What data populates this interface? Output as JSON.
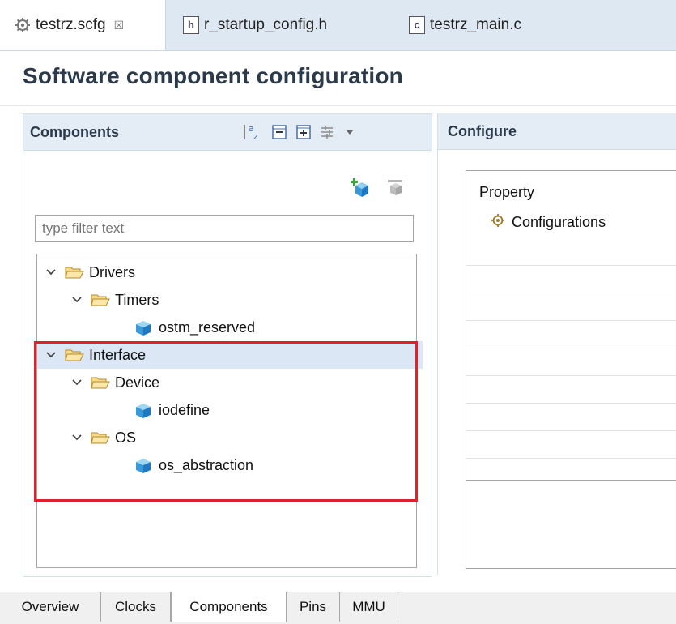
{
  "editor_tabs": [
    {
      "label": "testrz.scfg",
      "icon": "gear-file-icon",
      "active": true,
      "close_glyph": "☒"
    },
    {
      "label": "r_startup_config.h",
      "icon": "h-file-icon",
      "glyph": "h"
    },
    {
      "label": "testrz_main.c",
      "icon": "c-file-icon",
      "glyph": "c"
    }
  ],
  "page": {
    "title": "Software component configuration"
  },
  "components": {
    "title": "Components",
    "toolbar_icons": [
      "sort-az-icon",
      "collapse-all-icon",
      "expand-all-icon",
      "filter-icon",
      "dropdown-icon"
    ],
    "sort_glyph": "↓ᵃz",
    "filter_placeholder": "type filter text",
    "tree": [
      {
        "label": "Drivers",
        "type": "folder",
        "level": 0,
        "expanded": true
      },
      {
        "label": "Timers",
        "type": "folder",
        "level": 1,
        "expanded": true
      },
      {
        "label": "ostm_reserved",
        "type": "component",
        "level": 2
      },
      {
        "label": "Interface",
        "type": "folder",
        "level": 0,
        "expanded": true,
        "selected": true
      },
      {
        "label": "Device",
        "type": "folder",
        "level": 1,
        "expanded": true
      },
      {
        "label": "iodefine",
        "type": "component",
        "level": 2
      },
      {
        "label": "OS",
        "type": "folder",
        "level": 1,
        "expanded": true
      },
      {
        "label": "os_abstraction",
        "type": "component",
        "level": 2
      }
    ]
  },
  "configure": {
    "title": "Configure",
    "property_header": "Property",
    "first_row": "Configurations"
  },
  "bottom_tabs": [
    {
      "label": "Overview"
    },
    {
      "label": "Clocks"
    },
    {
      "label": "Components",
      "active": true
    },
    {
      "label": "Pins"
    },
    {
      "label": "MMU"
    }
  ],
  "colors": {
    "highlight": "#e0202a",
    "selection": "#dbe7f5",
    "header_bg": "#e4ecf5",
    "tab_bg": "#dde8f3"
  }
}
